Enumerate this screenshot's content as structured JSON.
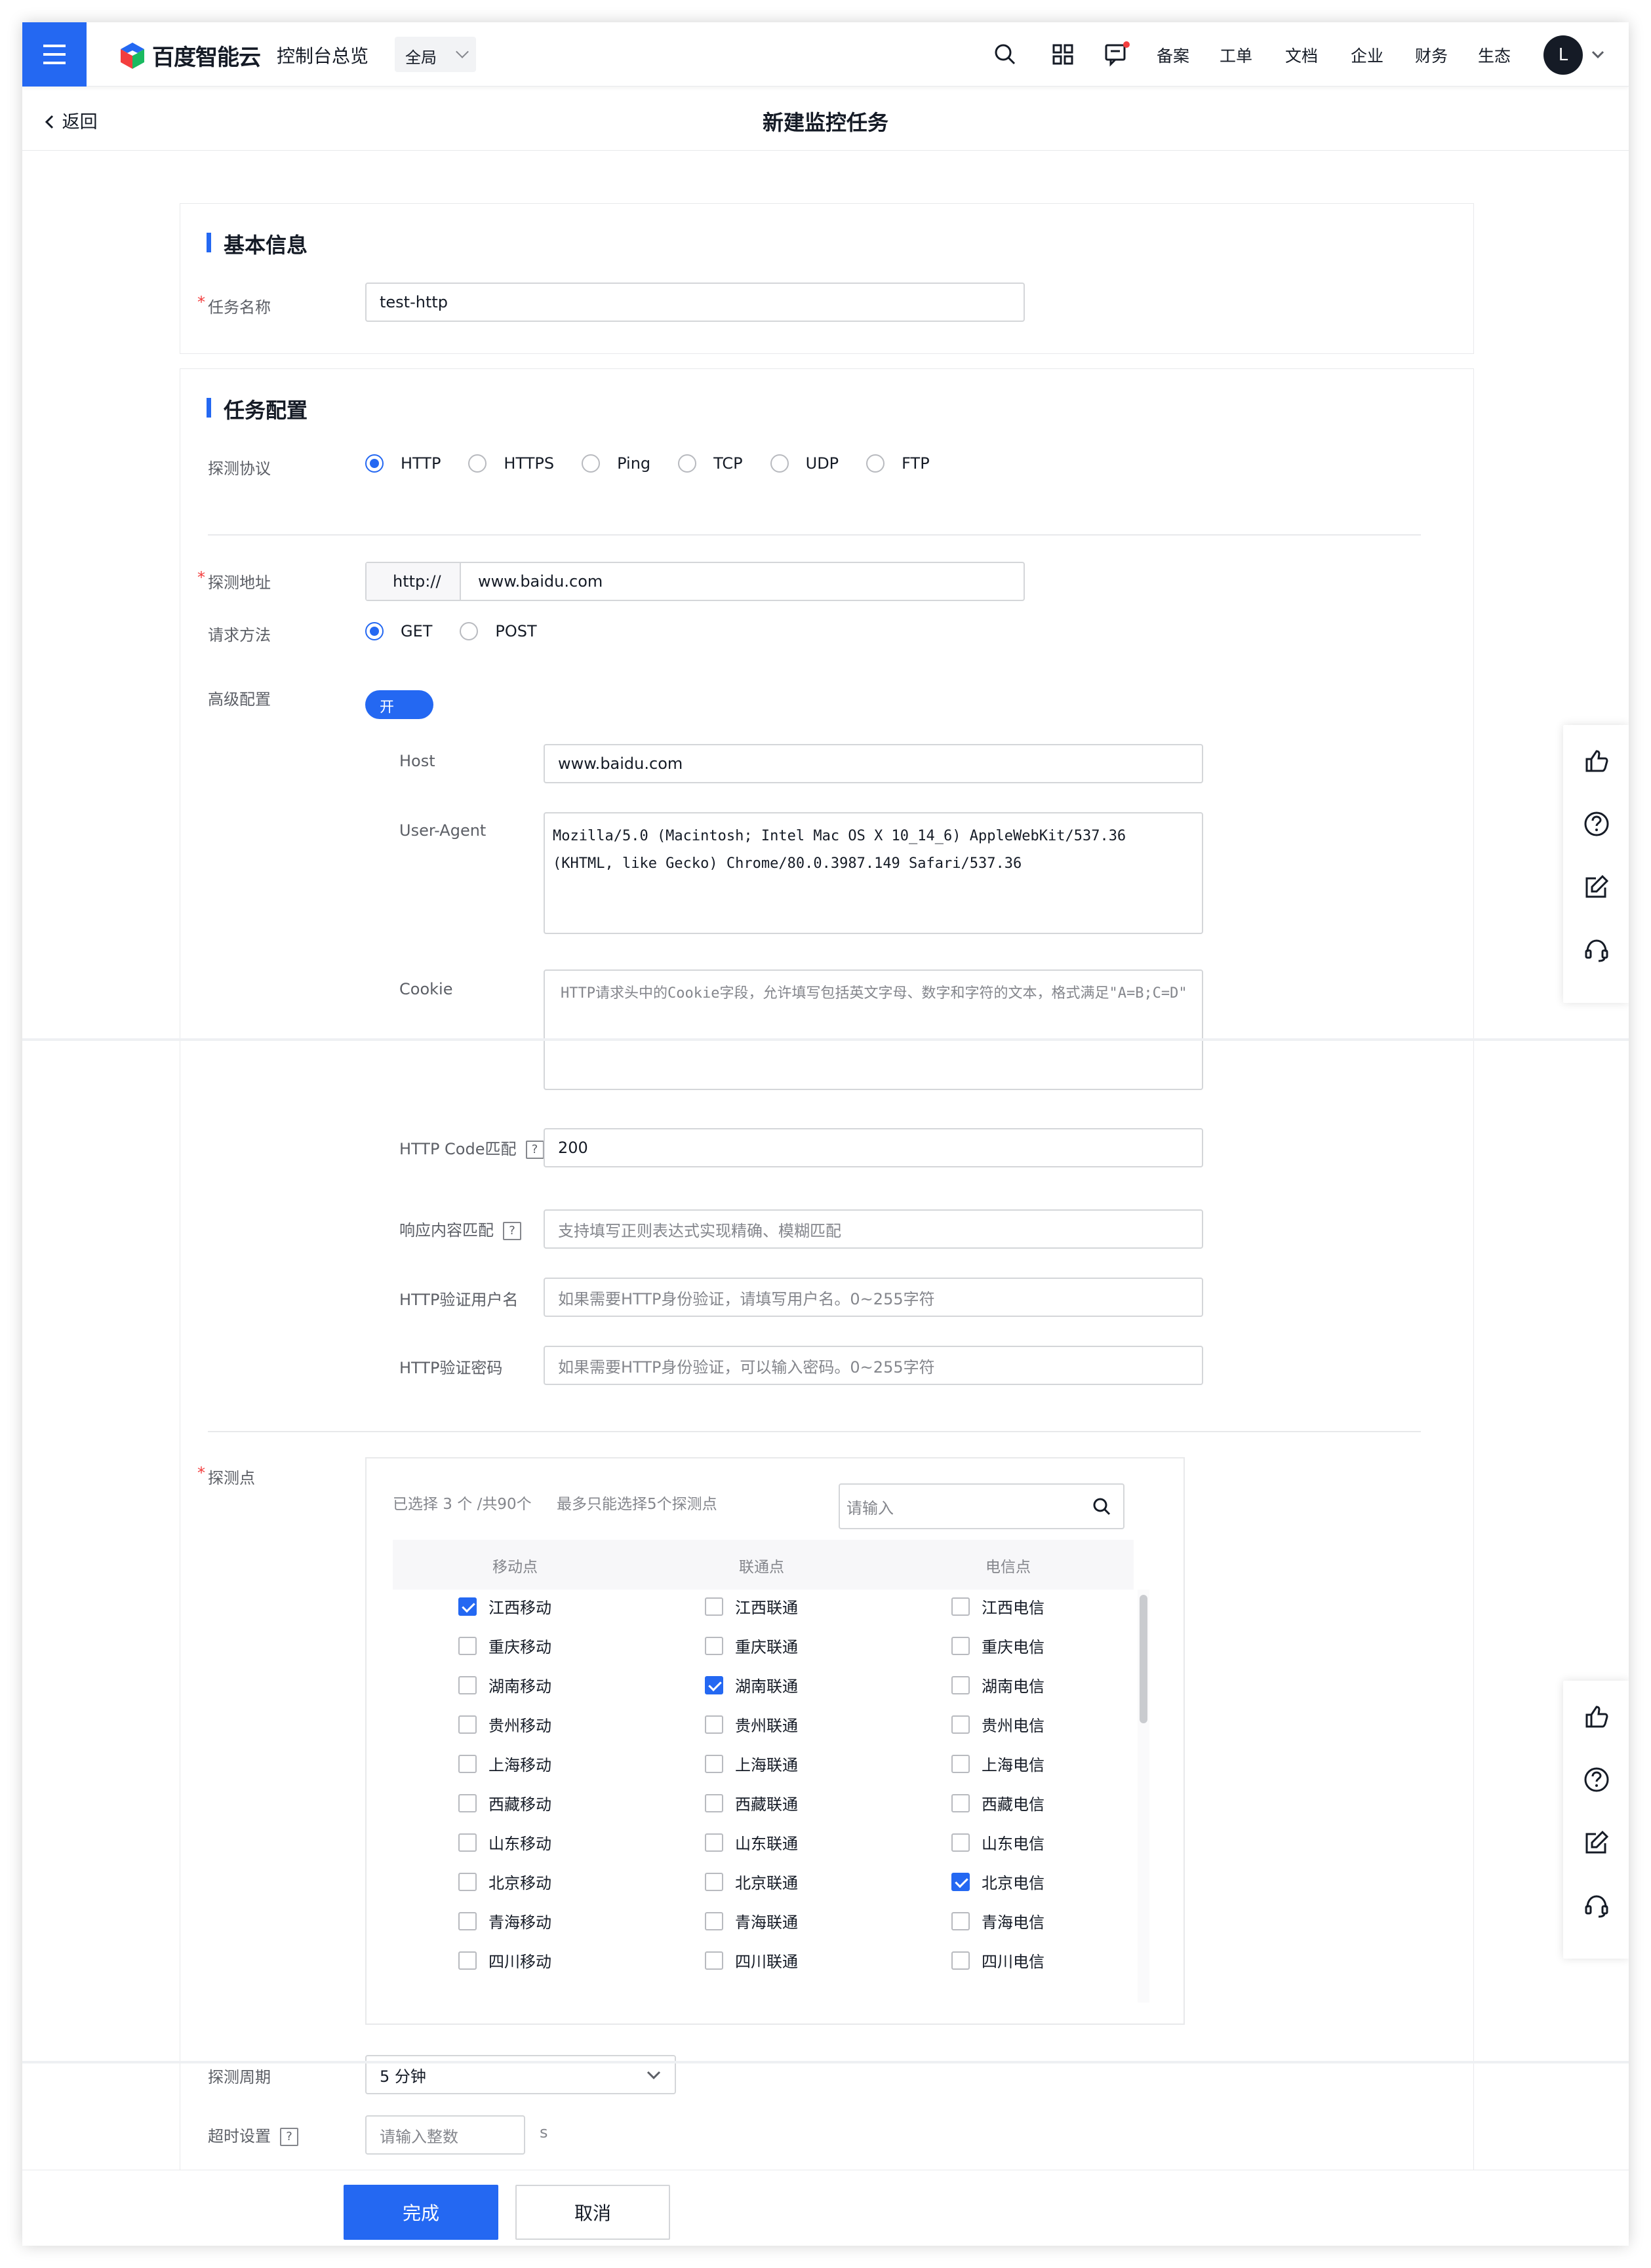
{
  "header": {
    "brand": "百度智能云",
    "console_link": "控制台总览",
    "scope": "全局",
    "nav": [
      "备案",
      "工单",
      "文档",
      "企业",
      "财务",
      "生态"
    ],
    "avatar_letter": "L"
  },
  "subheader": {
    "back_label": "返回",
    "title": "新建监控任务"
  },
  "basic": {
    "title": "基本信息",
    "task_name_label": "任务名称",
    "task_name_value": "test-http"
  },
  "config": {
    "title": "任务配置",
    "protocol_label": "探测协议",
    "protocols": [
      {
        "label": "HTTP",
        "selected": true
      },
      {
        "label": "HTTPS",
        "selected": false
      },
      {
        "label": "Ping",
        "selected": false
      },
      {
        "label": "TCP",
        "selected": false
      },
      {
        "label": "UDP",
        "selected": false
      },
      {
        "label": "FTP",
        "selected": false
      }
    ],
    "address_label": "探测地址",
    "address_prefix": "http://",
    "address_value": "www.baidu.com",
    "method_label": "请求方法",
    "methods": [
      {
        "label": "GET",
        "selected": true
      },
      {
        "label": "POST",
        "selected": false
      }
    ],
    "advanced_label": "高级配置",
    "advanced_switch": "开",
    "host_label": "Host",
    "host_value": "www.baidu.com",
    "ua_label": "User-Agent",
    "ua_value": "Mozilla/5.0 (Macintosh; Intel Mac OS X 10_14_6) AppleWebKit/537.36 (KHTML, like Gecko) Chrome/80.0.3987.149 Safari/537.36",
    "cookie_label": "Cookie",
    "cookie_placeholder": "HTTP请求头中的Cookie字段，允许填写包括英文字母、数字和字符的文本，格式满足\"A=B;C=D\"",
    "code_label": "HTTP Code匹配",
    "code_value": "200",
    "content_label": "响应内容匹配",
    "content_placeholder": "支持填写正则表达式实现精确、模糊匹配",
    "user_label": "HTTP验证用户名",
    "user_placeholder": "如果需要HTTP身份验证，请填写用户名。0~255字符",
    "pass_label": "HTTP验证密码",
    "pass_placeholder": "如果需要HTTP身份验证，可以输入密码。0~255字符",
    "qmark": "?"
  },
  "probe": {
    "label": "探测点",
    "summary": "已选择 3 个 /共90个",
    "limit": "最多只能选择5个探测点",
    "search_placeholder": "请输入",
    "columns": [
      "移动点",
      "联通点",
      "电信点"
    ],
    "rows": [
      [
        {
          "label": "江西移动",
          "checked": true
        },
        {
          "label": "江西联通",
          "checked": false
        },
        {
          "label": "江西电信",
          "checked": false
        }
      ],
      [
        {
          "label": "重庆移动",
          "checked": false
        },
        {
          "label": "重庆联通",
          "checked": false
        },
        {
          "label": "重庆电信",
          "checked": false
        }
      ],
      [
        {
          "label": "湖南移动",
          "checked": false
        },
        {
          "label": "湖南联通",
          "checked": true
        },
        {
          "label": "湖南电信",
          "checked": false
        }
      ],
      [
        {
          "label": "贵州移动",
          "checked": false
        },
        {
          "label": "贵州联通",
          "checked": false
        },
        {
          "label": "贵州电信",
          "checked": false
        }
      ],
      [
        {
          "label": "上海移动",
          "checked": false
        },
        {
          "label": "上海联通",
          "checked": false
        },
        {
          "label": "上海电信",
          "checked": false
        }
      ],
      [
        {
          "label": "西藏移动",
          "checked": false
        },
        {
          "label": "西藏联通",
          "checked": false
        },
        {
          "label": "西藏电信",
          "checked": false
        }
      ],
      [
        {
          "label": "山东移动",
          "checked": false
        },
        {
          "label": "山东联通",
          "checked": false
        },
        {
          "label": "山东电信",
          "checked": false
        }
      ],
      [
        {
          "label": "北京移动",
          "checked": false
        },
        {
          "label": "北京联通",
          "checked": false
        },
        {
          "label": "北京电信",
          "checked": true
        }
      ],
      [
        {
          "label": "青海移动",
          "checked": false
        },
        {
          "label": "青海联通",
          "checked": false
        },
        {
          "label": "青海电信",
          "checked": false
        }
      ],
      [
        {
          "label": "四川移动",
          "checked": false
        },
        {
          "label": "四川联通",
          "checked": false
        },
        {
          "label": "四川电信",
          "checked": false
        }
      ]
    ]
  },
  "period": {
    "label": "探测周期",
    "value": "5 分钟"
  },
  "timeout": {
    "label": "超时设置",
    "placeholder": "请输入整数",
    "unit": "s"
  },
  "actions": {
    "submit": "完成",
    "cancel": "取消"
  },
  "colors": {
    "accent": "#2468f2",
    "required": "#f33e3e"
  }
}
